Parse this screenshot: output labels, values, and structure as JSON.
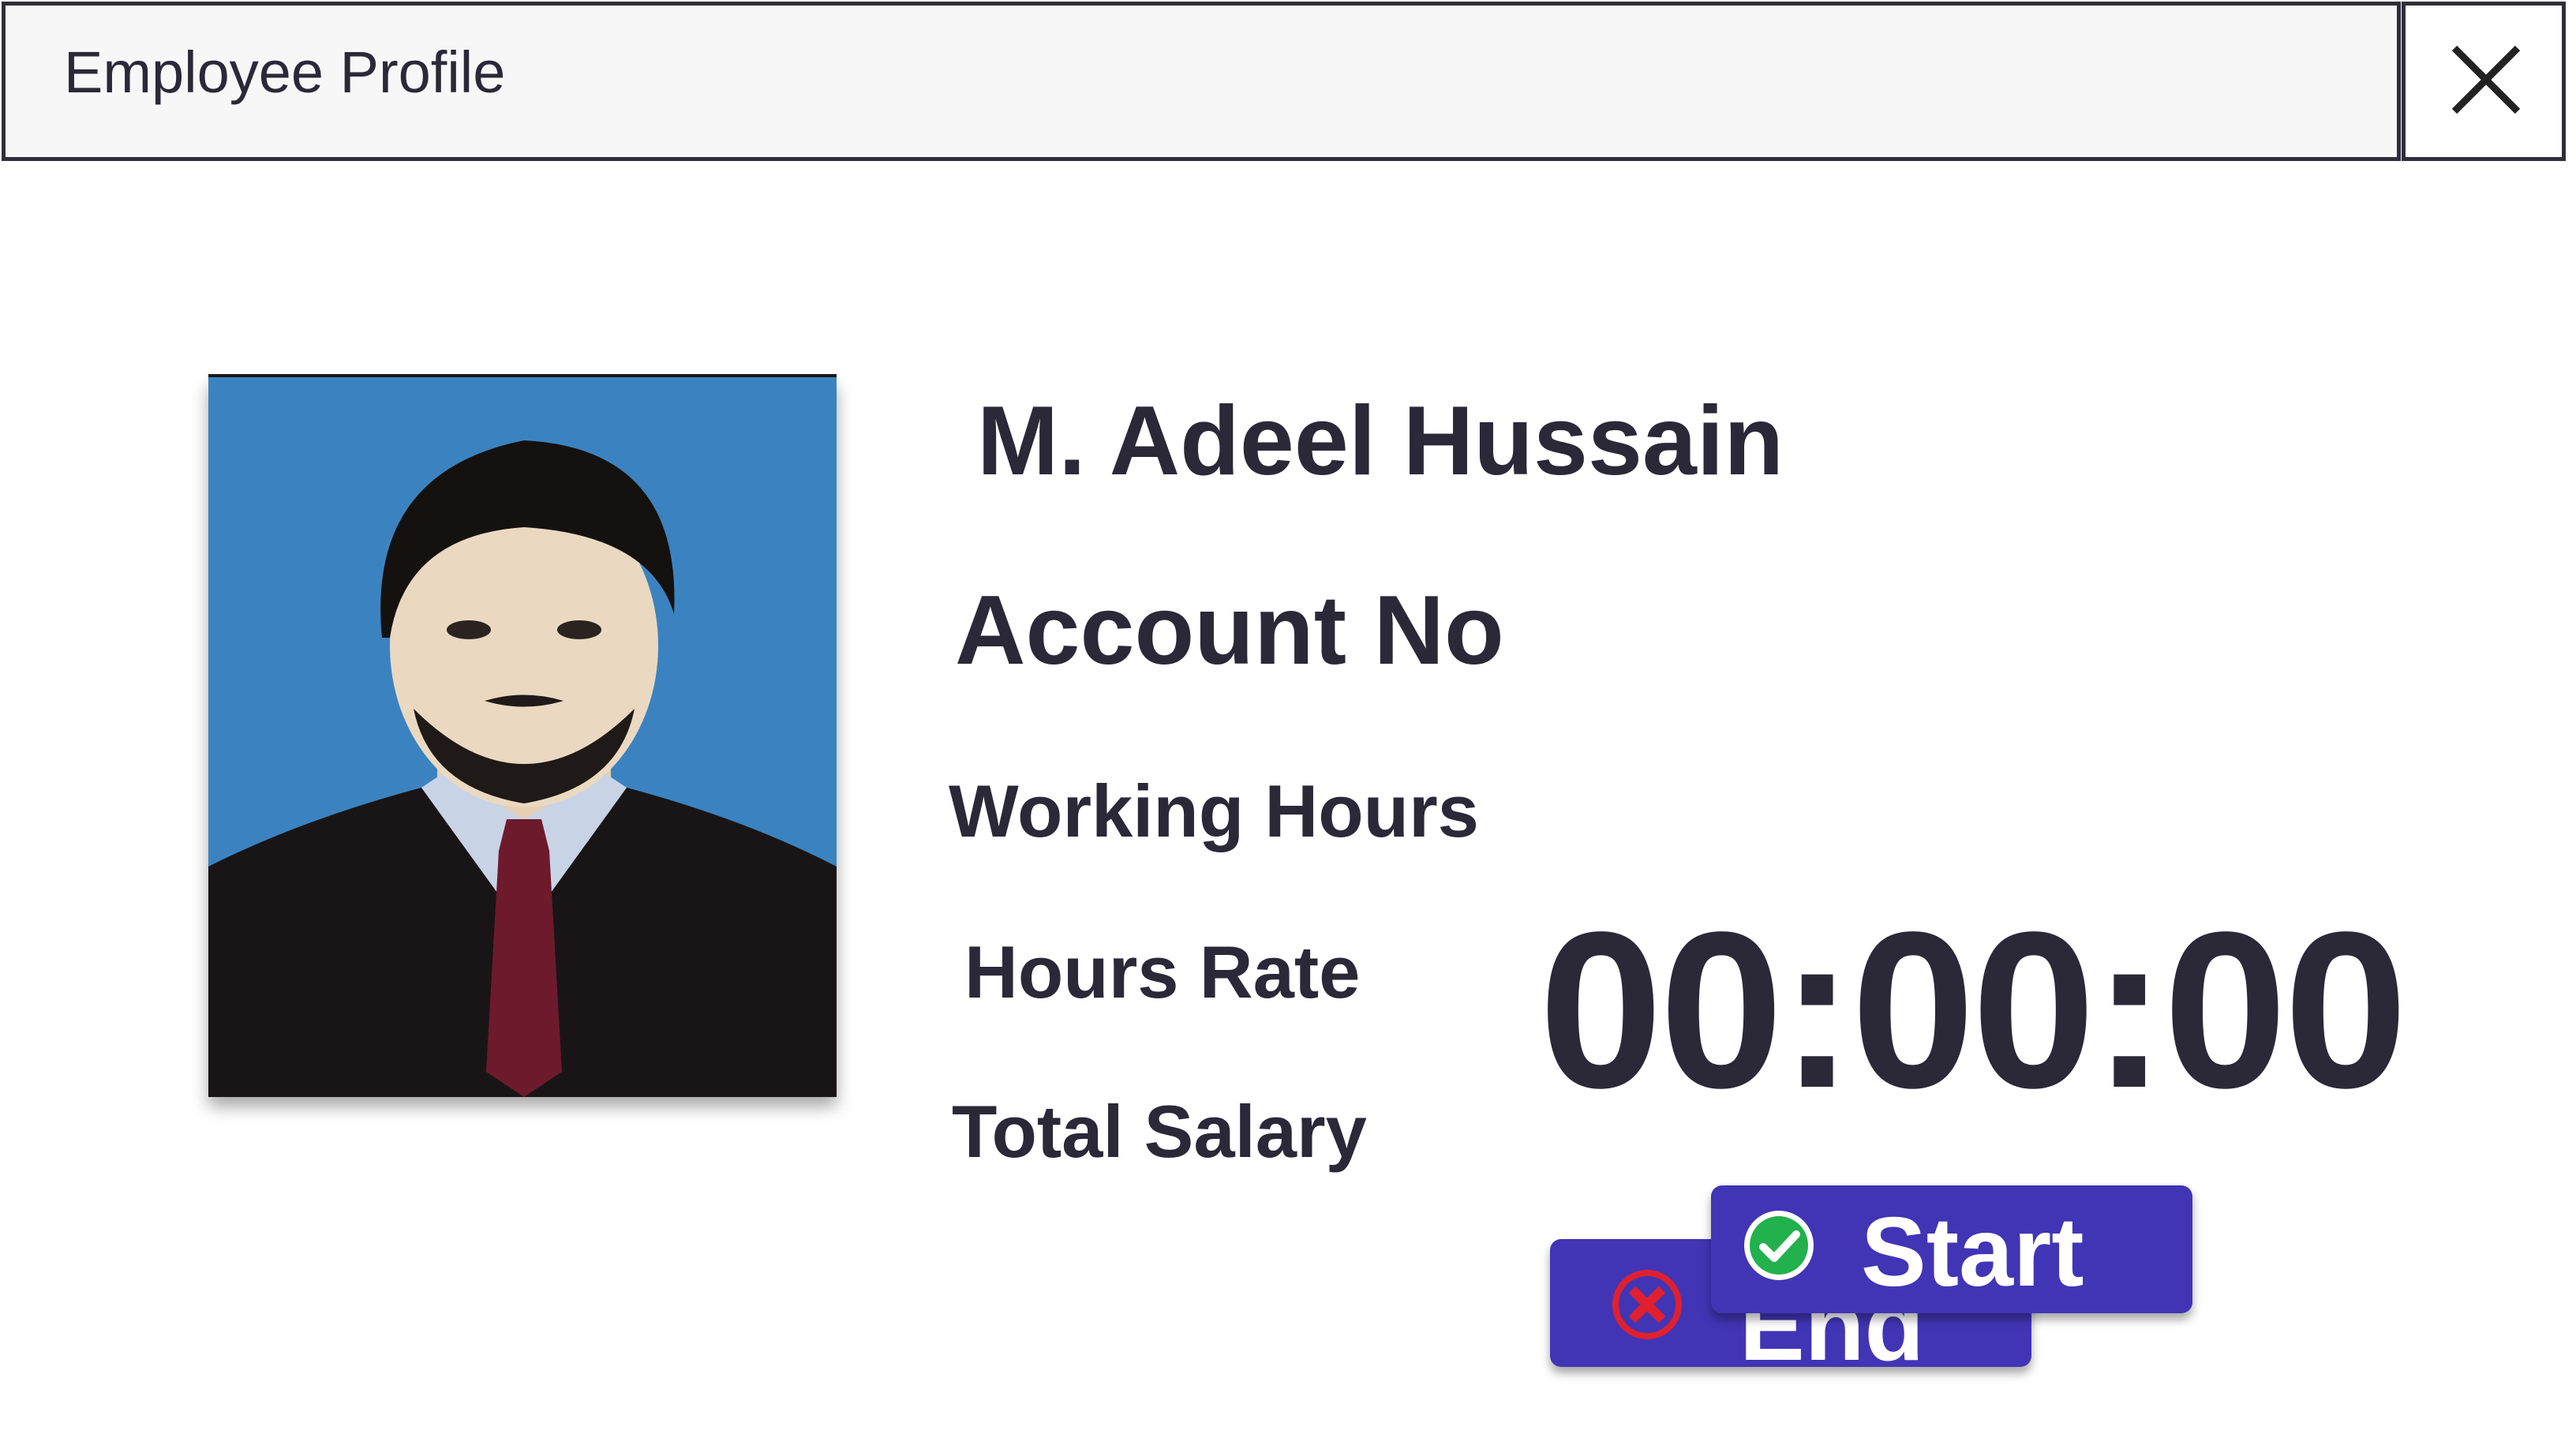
{
  "window": {
    "title": "Employee Profile",
    "close_icon": "close-icon"
  },
  "profile": {
    "photo_icon": "employee-photo",
    "name": "M. Adeel Hussain",
    "account_label": "Account No",
    "working_hours_label": "Working Hours",
    "hours_rate_label": "Hours Rate",
    "total_salary_label": "Total Salary"
  },
  "timer": {
    "value": "00:00:00"
  },
  "actions": {
    "start_label": "Start",
    "start_icon": "check-circle-icon",
    "end_label": "End",
    "end_icon": "cross-circle-icon"
  },
  "colors": {
    "button_bg": "#4135b5",
    "text": "#2b2838",
    "titlebar_bg": "#f7f7f7",
    "photo_bg": "#3b83c0",
    "start_icon": "#22b14c",
    "end_icon": "#e0202e"
  }
}
